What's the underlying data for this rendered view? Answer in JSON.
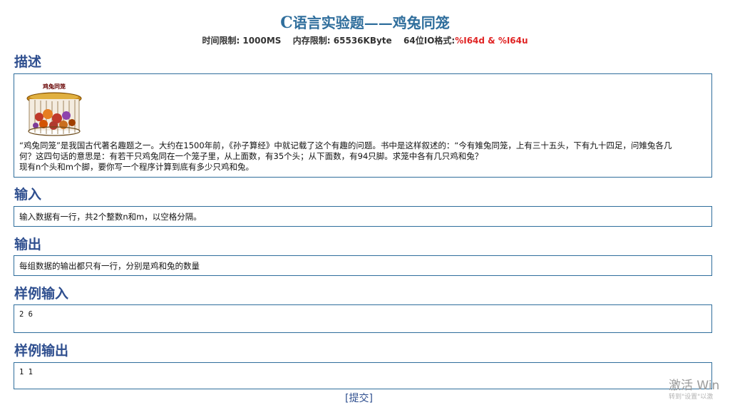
{
  "problem": {
    "title_c": "C",
    "title_rest": "语言实验题——鸡兔同笼",
    "limits": {
      "time": "时间限制: 1000MS",
      "memory": "内存限制: 65536KByte",
      "io_label": "64位IO格式:",
      "io_value": "%I64d & %I64u"
    }
  },
  "sections": {
    "description": {
      "heading": "描述",
      "image_caption": "鸡兔同笼",
      "line1": "“鸡兔同笼”是我国古代著名趣题之一。大约在1500年前，《孙子算经》中就记载了这个有趣的问题。书中是这样叙述的：“今有雉兔同笼，上有三十五头，下有九十四足，问雉兔各几",
      "line2": "何？这四句话的意思是：有若干只鸡兔同在一个笼子里，从上面数，有35个头；从下面数，有94只脚。求笼中各有几只鸡和兔？",
      "line3": "现有n个头和m个脚，要你写一个程序计算到底有多少只鸡和兔。"
    },
    "input": {
      "heading": "输入",
      "text": "输入数据有一行，共2个整数n和m，以空格分隔。"
    },
    "output": {
      "heading": "输出",
      "text": "每组数据的输出都只有一行，分别是鸡和兔的数量"
    },
    "sample_input": {
      "heading": "样例输入",
      "text": "2 6"
    },
    "sample_output": {
      "heading": "样例输出",
      "text": "1 1"
    }
  },
  "footer": {
    "submit": "[提交]"
  },
  "overlay": {
    "activate": "激活 Win",
    "activate_sub": "转到\"设置\"以激"
  }
}
